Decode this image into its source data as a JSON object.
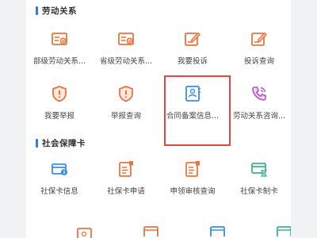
{
  "sections": {
    "labor": {
      "title": "劳动关系",
      "items": [
        {
          "label": "部级劳动关系...",
          "icon": "certificate-icon"
        },
        {
          "label": "省级劳动关系...",
          "icon": "certificate-icon"
        },
        {
          "label": "我要投诉",
          "icon": "edit-icon"
        },
        {
          "label": "投诉查询",
          "icon": "edit-icon"
        },
        {
          "label": "我要举报",
          "icon": "shield-alert-icon"
        },
        {
          "label": "举报查询",
          "icon": "shield-alert-icon"
        },
        {
          "label": "合同备案信息...",
          "icon": "contract-icon"
        },
        {
          "label": "劳动关系咨询...",
          "icon": "phone-icon"
        }
      ]
    },
    "social": {
      "title": "社会保障卡",
      "items": [
        {
          "label": "社保卡信息",
          "icon": "card-info-icon"
        },
        {
          "label": "社保卡申请",
          "icon": "document-flag-icon"
        },
        {
          "label": "申领审核查询",
          "icon": "document-flag-icon"
        },
        {
          "label": "社保卡制卡",
          "icon": "card-hourglass-icon"
        }
      ]
    }
  },
  "colors": {
    "accent": "#2f7be8",
    "icon_orange": "#e9743c",
    "icon_blue": "#3b8fe0",
    "icon_green": "#3fb38a",
    "icon_purple": "#b64fc8",
    "highlight": "#e0483f"
  }
}
